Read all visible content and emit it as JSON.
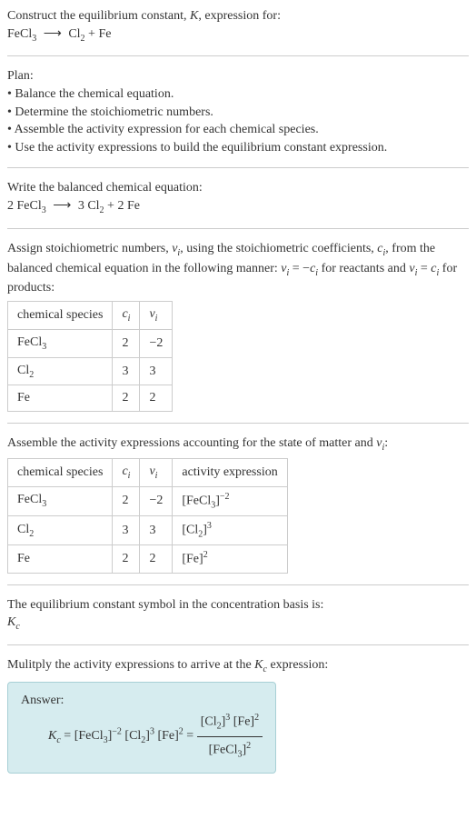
{
  "header": {
    "line1_a": "Construct the equilibrium constant, ",
    "line1_b": ", expression for:",
    "eq_lhs": "FeCl",
    "eq_sub1": "3",
    "arrow": "⟶",
    "eq_rhs1": "Cl",
    "eq_sub2": "2",
    "eq_plus": " + Fe"
  },
  "plan": {
    "title": "Plan:",
    "b1": "• Balance the chemical equation.",
    "b2": "• Determine the stoichiometric numbers.",
    "b3": "• Assemble the activity expression for each chemical species.",
    "b4": "• Use the activity expressions to build the equilibrium constant expression."
  },
  "balanced": {
    "title": "Write the balanced chemical equation:",
    "c1": "2 FeCl",
    "s1": "3",
    "arrow": "⟶",
    "c2": "3 Cl",
    "s2": "2",
    "c3": " + 2 Fe"
  },
  "stoich": {
    "intro_a": "Assign stoichiometric numbers, ",
    "nu": "ν",
    "i": "i",
    "intro_b": ", using the stoichiometric coefficients, ",
    "c": "c",
    "intro_c": ", from the balanced chemical equation in the following manner: ",
    "rel1_a": " = −",
    "rel1_b": " for reactants and ",
    "rel2_a": " = ",
    "rel2_b": " for products:"
  },
  "table1": {
    "h1": "chemical species",
    "h2": "c",
    "h3": "ν",
    "hsub": "i",
    "r1c1a": "FeCl",
    "r1c1b": "3",
    "r1c2": "2",
    "r1c3": "−2",
    "r2c1a": "Cl",
    "r2c1b": "2",
    "r2c2": "3",
    "r2c3": "3",
    "r3c1": "Fe",
    "r3c2": "2",
    "r3c3": "2"
  },
  "activity": {
    "intro_a": "Assemble the activity expressions accounting for the state of matter and ",
    "nu": "ν",
    "i": "i",
    "intro_b": ":"
  },
  "table2": {
    "h1": "chemical species",
    "h2": "c",
    "h3": "ν",
    "h4": "activity expression",
    "hsub": "i",
    "r1c1a": "FeCl",
    "r1c1b": "3",
    "r1c2": "2",
    "r1c3": "−2",
    "r1c4a": "[FeCl",
    "r1c4b": "3",
    "r1c4c": "]",
    "r1c4d": "−2",
    "r2c1a": "Cl",
    "r2c1b": "2",
    "r2c2": "3",
    "r2c3": "3",
    "r2c4a": "[Cl",
    "r2c4b": "2",
    "r2c4c": "]",
    "r2c4d": "3",
    "r3c1": "Fe",
    "r3c2": "2",
    "r3c3": "2",
    "r3c4a": "[Fe]",
    "r3c4b": "2"
  },
  "symbol": {
    "line1": "The equilibrium constant symbol in the concentration basis is:",
    "K": "K",
    "c": "c"
  },
  "multiply": {
    "line_a": "Mulitply the activity expressions to arrive at the ",
    "K": "K",
    "c": "c",
    "line_b": " expression:"
  },
  "answer": {
    "label": "Answer:",
    "K": "K",
    "c": "c",
    "eq": " = ",
    "t1a": "[FeCl",
    "t1b": "3",
    "t1c": "]",
    "t1d": "−2",
    "sp": " ",
    "t2a": "[Cl",
    "t2b": "2",
    "t2c": "]",
    "t2d": "3",
    "t3a": "[Fe]",
    "t3b": "2",
    "eq2": " = ",
    "num_a": "[Cl",
    "num_b": "2",
    "num_c": "]",
    "num_d": "3",
    "num_e": " [Fe]",
    "num_f": "2",
    "den_a": "[FeCl",
    "den_b": "3",
    "den_c": "]",
    "den_d": "2"
  }
}
